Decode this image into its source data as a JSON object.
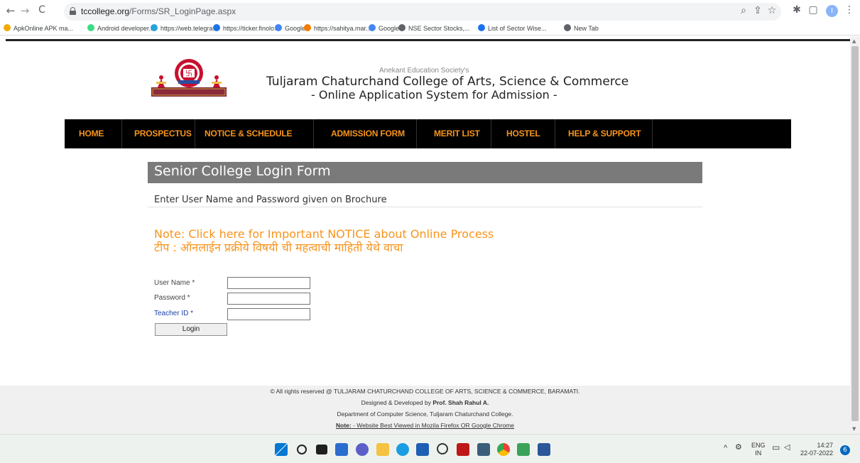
{
  "browser": {
    "url_domain": "tccollege.org",
    "url_path": "/Forms/SR_LoginPage.aspx",
    "back_icon": "←",
    "forward_icon": "→",
    "reload_icon": "C",
    "profile_initial": "I"
  },
  "bookmarks": [
    {
      "label": "ApkOnline APK ma...",
      "color": "#f2a900"
    },
    {
      "label": "Android developer...",
      "color": "#3ddc84"
    },
    {
      "label": "https://web.telegra...",
      "color": "#2aa1da"
    },
    {
      "label": "https://ticker.finolo...",
      "color": "#1a73e8"
    },
    {
      "label": "Google",
      "color": "#4285f4"
    },
    {
      "label": "https://sahitya.mar...",
      "color": "#f57c00"
    },
    {
      "label": "Google",
      "color": "#4285f4"
    },
    {
      "label": "NSE Sector Stocks,...",
      "color": "#5f6368"
    },
    {
      "label": "List of Sector Wise...",
      "color": "#1a73e8"
    },
    {
      "label": "New Tab",
      "color": "#5f6368"
    }
  ],
  "header": {
    "society": "Anekant Education Society's",
    "college": "Tuljaram Chaturchand College of Arts, Science & Commerce",
    "system": "- Online Application System for Admission -"
  },
  "menu": [
    "HOME",
    "PROSPECTUS",
    "NOTICE & SCHEDULE",
    "ADMISSION FORM",
    "MERIT LIST",
    "HOSTEL",
    "HELP & SUPPORT"
  ],
  "form": {
    "title": "Senior College Login Form",
    "instruction": "Enter User Name and Password given on Brochure",
    "note_en": "Note: Click here for Important NOTICE about Online Process",
    "note_mr": "टीप : ऑनलाईन प्रक्रीये विषयी ची महत्वाची माहिती येथे वाचा",
    "username_label": "User Name *",
    "password_label": "Password *",
    "teacher_label": "Teacher ID *",
    "username_value": "",
    "password_value": "",
    "teacher_value": "",
    "login_label": "Login"
  },
  "footer": {
    "line1": "© All rights reserved @ TULJARAM CHATURCHAND COLLEGE OF ARTS, SCIENCE & COMMERCE, BARAMATI.",
    "line2_prefix": "Designed & Developed by ",
    "line2_name": "Prof. Shah Rahul A.",
    "line3": "Department of Computer Science, Tuljaram Chaturchand College.",
    "line4_label": "Note:",
    "line4_text": " - Website Best Viewed in Mozila Firefox OR Google Chrome"
  },
  "taskbar": {
    "lang_top": "ENG",
    "lang_bottom": "IN",
    "time": "14:27",
    "date": "22-07-2022",
    "notifications": "6",
    "colors": {
      "accent": "#0067c0",
      "menu_orange": "#f7941d"
    }
  }
}
